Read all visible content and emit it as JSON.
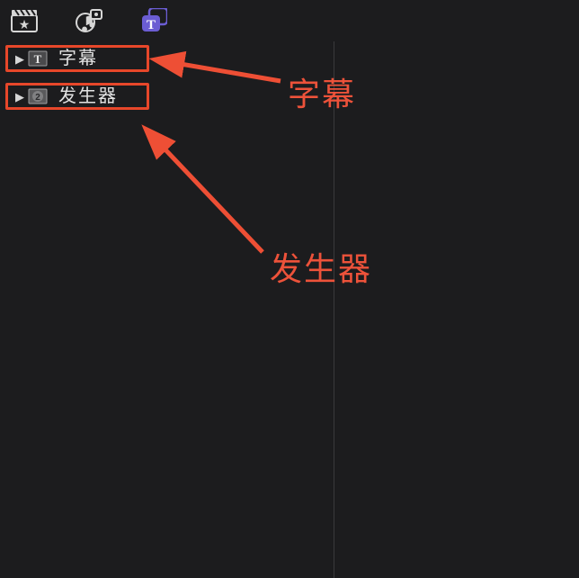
{
  "toolbar": {
    "tabs": [
      {
        "name": "media-library-tab"
      },
      {
        "name": "audio-library-tab"
      },
      {
        "name": "titles-generators-tab"
      }
    ]
  },
  "sidebar": {
    "items": [
      {
        "label": "字幕"
      },
      {
        "label": "发生器"
      }
    ]
  },
  "annotations": {
    "subtitles_label": "字幕",
    "generators_label": "发生器"
  },
  "colors": {
    "highlight": "#e7472a",
    "annotation": "#ed523a",
    "accent": "#6b5dd3",
    "background": "#1c1c1e"
  }
}
